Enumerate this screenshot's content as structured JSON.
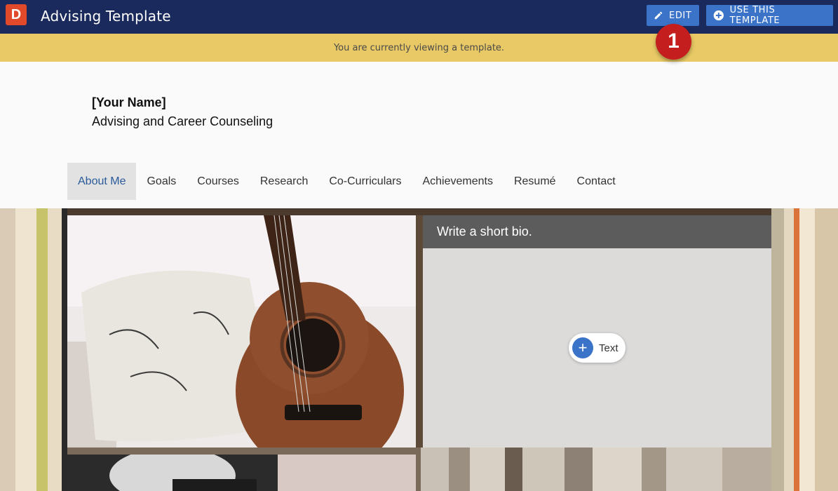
{
  "app": {
    "logo_letter": "D",
    "title": "Advising Template"
  },
  "toolbar": {
    "edit_label": "EDIT",
    "use_template_label": "USE THIS TEMPLATE"
  },
  "banner": {
    "message": "You are currently viewing a template."
  },
  "annotation": {
    "step_number": "1"
  },
  "header": {
    "name": "[Your Name]",
    "subtitle": "Advising and Career Counseling"
  },
  "nav": {
    "items": [
      {
        "label": "About Me",
        "active": true
      },
      {
        "label": "Goals"
      },
      {
        "label": "Courses"
      },
      {
        "label": "Research"
      },
      {
        "label": "Co-Curriculars"
      },
      {
        "label": "Achievements"
      },
      {
        "label": "Resumé"
      },
      {
        "label": "Contact"
      }
    ]
  },
  "bio": {
    "header": "Write a short bio.",
    "add_text_label": "Text"
  },
  "colors": {
    "topbar": "#1b2a5c",
    "accent": "#3a73c7",
    "banner": "#e8c965",
    "badge": "#c41e1e"
  }
}
